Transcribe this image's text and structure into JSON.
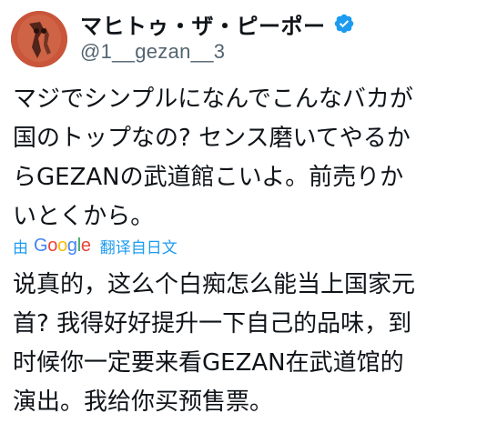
{
  "author": {
    "display_name": "マヒトゥ・ザ・ピーポー",
    "handle": "@1__gezan__3",
    "verified_badge_color": "#1d9bf0"
  },
  "tweet": {
    "original_lines": [
      "マジでシンプルになんでこんなバカが",
      "国のトップなの? センス磨いてやるか",
      "らGEZANの武道館こいよ。前売りか",
      "いとくから。"
    ]
  },
  "translation": {
    "by_label": "由",
    "provider_letters": [
      "G",
      "o",
      "o",
      "g",
      "l",
      "e"
    ],
    "link_label": "翻译自日文",
    "translated_lines": [
      "说真的，这么个白痴怎么能当上国家元",
      "首? 我得好好提升一下自己的品味，到",
      "时候你一定要来看GEZAN在武道馆的",
      "演出。我给你买预售票。"
    ]
  },
  "colors": {
    "text_primary": "#0f1419",
    "text_secondary": "#536471",
    "link": "#1d9bf0"
  },
  "icons": {
    "avatar": "avatar-image",
    "verified": "verified-badge-icon"
  }
}
